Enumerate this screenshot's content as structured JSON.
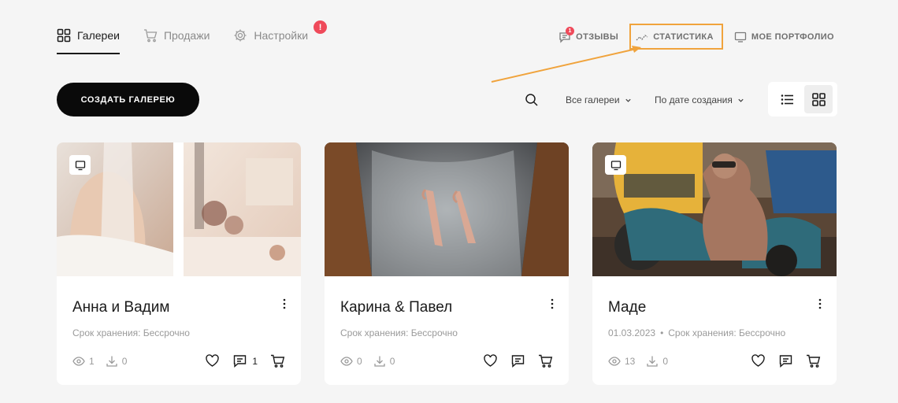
{
  "nav": {
    "tabs": [
      {
        "label": "Галереи",
        "icon": "grid-icon"
      },
      {
        "label": "Продажи",
        "icon": "cart-icon"
      },
      {
        "label": "Настройки",
        "icon": "gear-icon"
      }
    ],
    "settings_badge": "!"
  },
  "top_links": {
    "reviews": "ОТЗЫВЫ",
    "reviews_badge": "1",
    "statistics": "СТАТИСТИКА",
    "portfolio": "МОЕ ПОРТФОЛИО"
  },
  "toolbar": {
    "create_label": "СОЗДАТЬ ГАЛЕРЕЮ",
    "filter_all": "Все галереи",
    "sort_label": "По дате создания"
  },
  "cards": [
    {
      "title": "Анна и Вадим",
      "meta_date": "",
      "meta_storage": "Срок хранения: Бессрочно",
      "views": "1",
      "downloads": "0",
      "comments": "1"
    },
    {
      "title": "Карина & Павел",
      "meta_date": "",
      "meta_storage": "Срок хранения: Бессрочно",
      "views": "0",
      "downloads": "0",
      "comments": ""
    },
    {
      "title": "Маде",
      "meta_date": "01.03.2023",
      "meta_sep": "•",
      "meta_storage": "Срок хранения: Бессрочно",
      "views": "13",
      "downloads": "0",
      "comments": ""
    }
  ],
  "colors": {
    "accent_orange": "#f0a33c",
    "alert_red": "#ef4a5a",
    "primary": "#0a0a0a"
  }
}
